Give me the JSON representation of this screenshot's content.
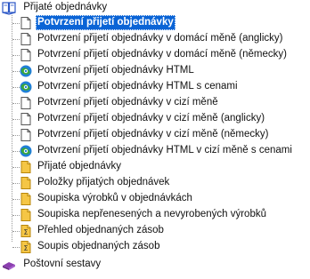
{
  "tree": {
    "root_label": "Přijaté objednávky",
    "items": [
      {
        "label": "Potvrzení přijetí objednávky",
        "icon": "document-icon",
        "selected": true
      },
      {
        "label": "Potvrzení přijetí objednávky v domácí měně (anglicky)",
        "icon": "document-icon"
      },
      {
        "label": "Potvrzení přijetí objednávky v domácí měně (německy)",
        "icon": "document-icon"
      },
      {
        "label": "Potvrzení přijetí objednávky HTML",
        "icon": "browser-icon"
      },
      {
        "label": "Potvrzení přijetí objednávky HTML s cenami",
        "icon": "browser-icon"
      },
      {
        "label": "Potvrzení přijetí objednávky v cizí měně",
        "icon": "document-icon"
      },
      {
        "label": "Potvrzení přijetí objednávky v cizí měně (anglicky)",
        "icon": "document-icon"
      },
      {
        "label": "Potvrzení přijetí objednávky v cizí měně (německy)",
        "icon": "document-icon"
      },
      {
        "label": "Potvrzení přijetí objednávky HTML v cizí měně s cenami",
        "icon": "browser-icon"
      },
      {
        "label": "Přijaté objednávky",
        "icon": "report-icon"
      },
      {
        "label": "Položky přijatých objednávek",
        "icon": "report-icon"
      },
      {
        "label": "Soupiska výrobků v objednávkách",
        "icon": "report-icon"
      },
      {
        "label": "Soupiska nepřenesených a nevyrobených výrobků",
        "icon": "report-icon"
      },
      {
        "label": "Přehled objednaných zásob",
        "icon": "sum-report-icon"
      },
      {
        "label": "Soupis objednaných zásob",
        "icon": "sum-report-icon"
      }
    ],
    "next_root_label": "Poštovní sestavy"
  },
  "colors": {
    "selection_bg": "#0a64d6",
    "book_blue": "#2b56c6",
    "book_purple": "#8b3fb0",
    "report_yellow": "#f5c645",
    "browser_blue": "#1f7fd8",
    "browser_green": "#3aa63a"
  }
}
